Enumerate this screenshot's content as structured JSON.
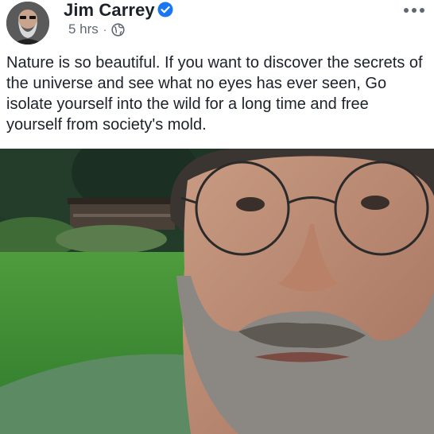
{
  "post": {
    "author": "Jim Carrey",
    "timestamp": "5 hrs",
    "separator": "·",
    "verified_icon": "verified-badge-icon",
    "privacy_icon": "globe-icon",
    "menu_icon": "more-options-icon",
    "text": "Nature is so beautiful. If you want to discover the secrets of the universe and see what no eyes has ever seen, Go isolate yourself into the wild for a long time and free yourself from society's mold.",
    "colors": {
      "name": "#1d2129",
      "meta": "#606770",
      "verified": "#1877f2"
    }
  }
}
